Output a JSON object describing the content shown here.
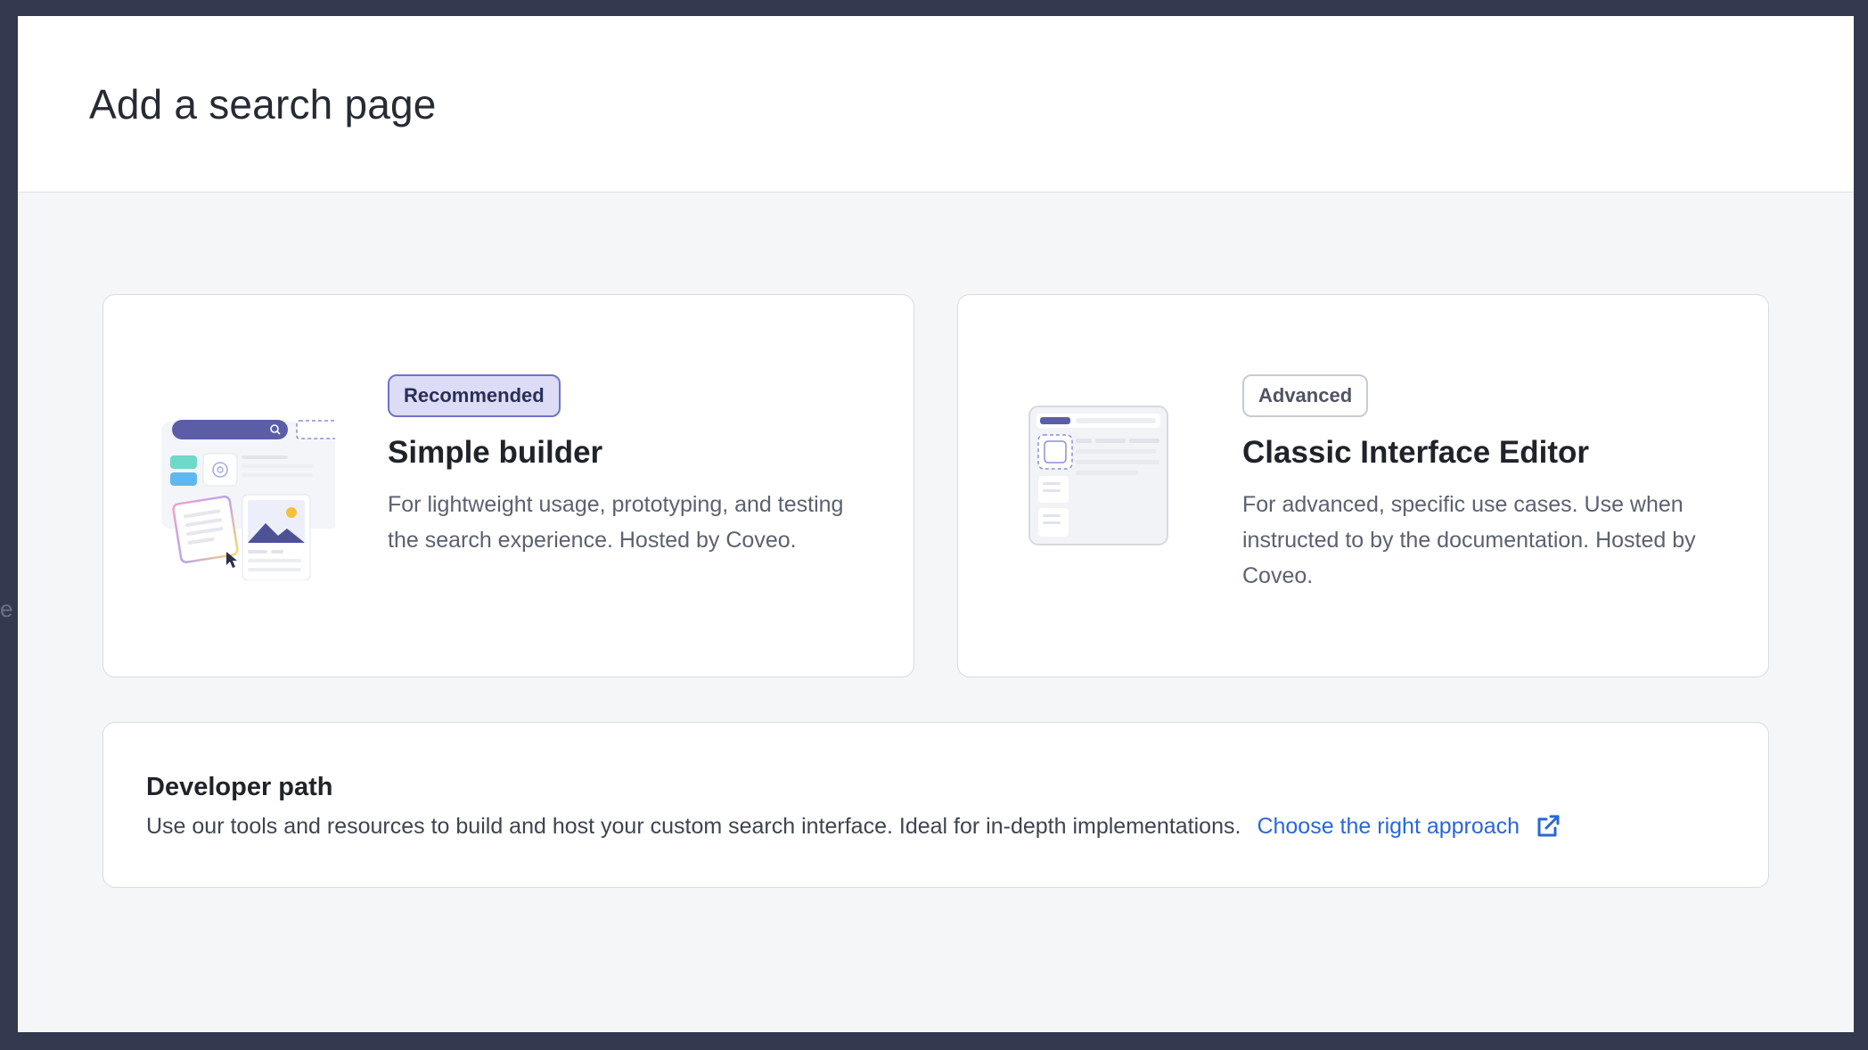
{
  "backdrop": {
    "partial_text": "e"
  },
  "modal": {
    "title": "Add a search page"
  },
  "options": [
    {
      "badge": "Recommended",
      "title": "Simple builder",
      "description": "For lightweight usage, prototyping, and testing the search experience. Hosted by Coveo."
    },
    {
      "badge": "Advanced",
      "title": "Classic Interface Editor",
      "description": "For advanced, specific use cases. Use when instructed to by the documentation. Hosted by Coveo."
    }
  ],
  "developer_path": {
    "title": "Developer path",
    "description": "Use our tools and resources to build and host your custom search interface. Ideal for in-depth implementations.",
    "link_label": "Choose the right approach",
    "link_icon": "external-link-icon"
  },
  "colors": {
    "accent_purple": "#5b5ea6",
    "recommended_badge_bg": "#dcdcf7",
    "link_blue": "#2a67d8"
  }
}
